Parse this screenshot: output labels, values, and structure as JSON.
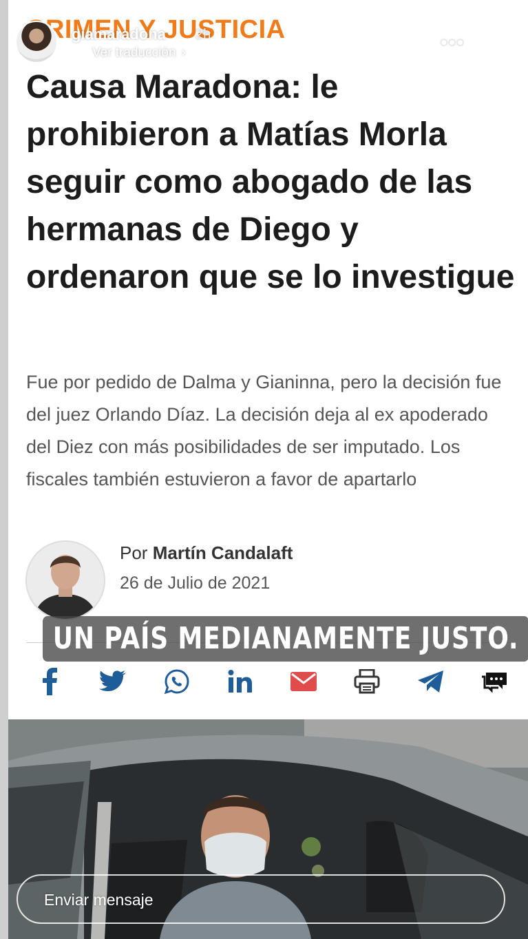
{
  "story": {
    "username": "giamaradona",
    "time_ago": "2h",
    "translate_label": "Ver traducción",
    "translate_chevron": "›",
    "more_label": "•••",
    "progress_segments": 8,
    "progress_current": 1
  },
  "article": {
    "section": "CRIMEN Y JUSTICIA",
    "headline": "Causa Maradona: le prohibieron a Matías Morla seguir como abogado de las hermanas de Diego y ordenaron que se lo investigue",
    "summary": "Fue por pedido de Dalma y Gianinna, pero la decisión fue del juez Orlando Díaz. La decisión deja al ex apoderado del Diez con más posibilidades de ser imputado. Los fiscales también estuvieron a favor de apartarlo",
    "byline_prefix": "Por",
    "author": "Martín Candalaft",
    "date": "26 de Julio de 2021",
    "share_icons": [
      "facebook-icon",
      "twitter-icon",
      "whatsapp-icon",
      "linkedin-icon",
      "email-icon",
      "print-icon",
      "telegram-icon",
      "comments-icon"
    ],
    "colors": {
      "section": "#f07b1a",
      "share": "#1f5d98",
      "headline": "#1c1c1c",
      "summary": "#555555"
    }
  },
  "sticker_text": "UN PAÍS MEDIANAMENTE JUSTO.",
  "reply": {
    "placeholder": "Enviar mensaje"
  }
}
